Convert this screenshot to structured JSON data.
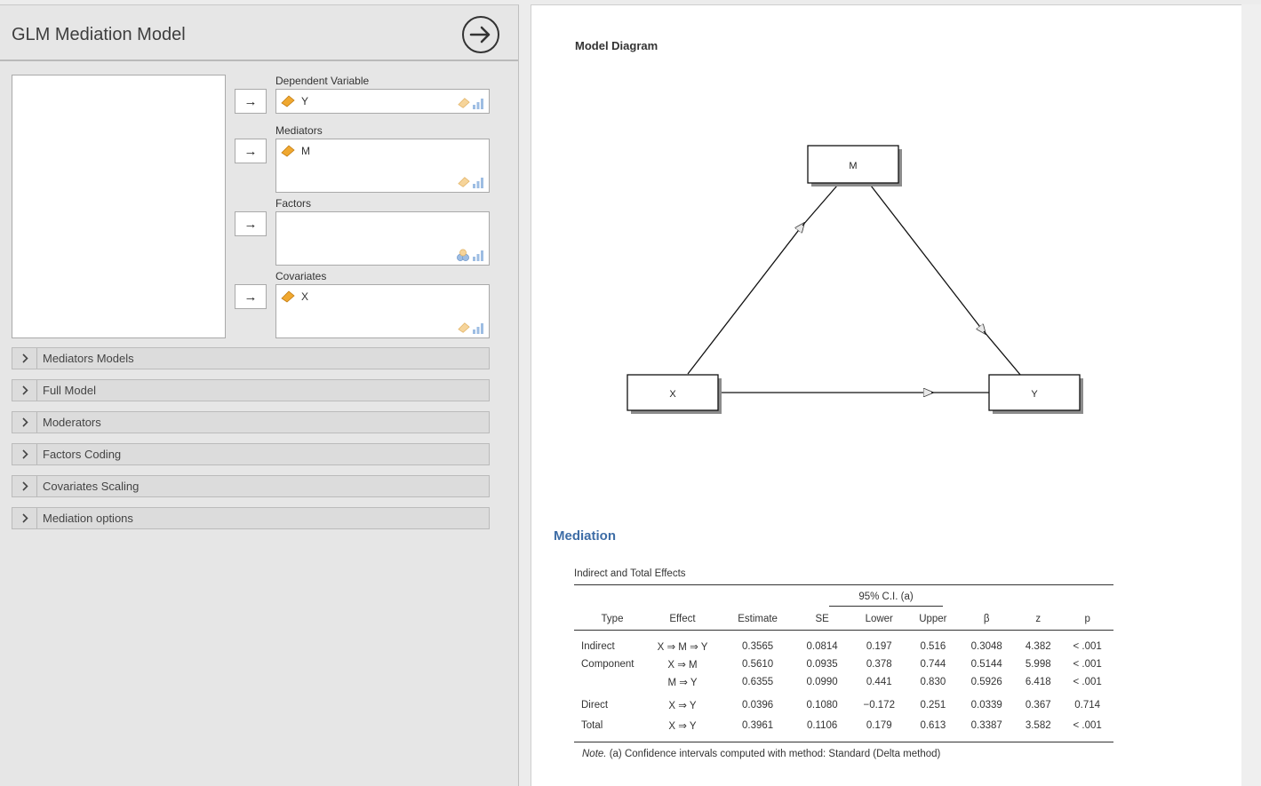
{
  "panel": {
    "title": "GLM Mediation Model",
    "run_icon": "arrow-right-circle-icon"
  },
  "targets": {
    "dependent": {
      "label": "Dependent Variable",
      "items": [
        "Y"
      ]
    },
    "mediators": {
      "label": "Mediators",
      "items": [
        "M"
      ]
    },
    "factors": {
      "label": "Factors",
      "items": []
    },
    "covariates": {
      "label": "Covariates",
      "items": [
        "X"
      ]
    }
  },
  "assign_arrow": "→",
  "sections": [
    "Mediators Models",
    "Full Model",
    "Moderators",
    "Factors Coding",
    "Covariates Scaling",
    "Mediation options"
  ],
  "diagram": {
    "title": "Model Diagram",
    "nodes": {
      "m": "M",
      "x": "X",
      "y": "Y"
    }
  },
  "results": {
    "heading": "Mediation",
    "table": {
      "title": "Indirect and Total Effects",
      "ci_group": "95% C.I. (a)",
      "columns": [
        "Type",
        "Effect",
        "Estimate",
        "SE",
        "Lower",
        "Upper",
        "β",
        "z",
        "p"
      ],
      "rows": [
        [
          "Indirect",
          "X ⇒ M ⇒ Y",
          "0.3565",
          "0.0814",
          "0.197",
          "0.516",
          "0.3048",
          "4.382",
          "< .001"
        ],
        [
          "Component",
          "X ⇒ M",
          "0.5610",
          "0.0935",
          "0.378",
          "0.744",
          "0.5144",
          "5.998",
          "< .001"
        ],
        [
          "",
          "M ⇒ Y",
          "0.6355",
          "0.0990",
          "0.441",
          "0.830",
          "0.5926",
          "6.418",
          "< .001"
        ],
        [
          "Direct",
          "X ⇒ Y",
          "0.0396",
          "0.1080",
          "−0.172",
          "0.251",
          "0.0339",
          "0.367",
          "0.714"
        ],
        [
          "Total",
          "X ⇒ Y",
          "0.3961",
          "0.1106",
          "0.179",
          "0.613",
          "0.3387",
          "3.582",
          "< .001"
        ]
      ],
      "note_prefix": "Note.",
      "note": "(a) Confidence intervals computed with method: Standard (Delta method)"
    }
  },
  "colors": {
    "heading_blue": "#3e6da6",
    "nominal_orange": "#f0a830",
    "scale_blue": "#7aa6d8"
  }
}
